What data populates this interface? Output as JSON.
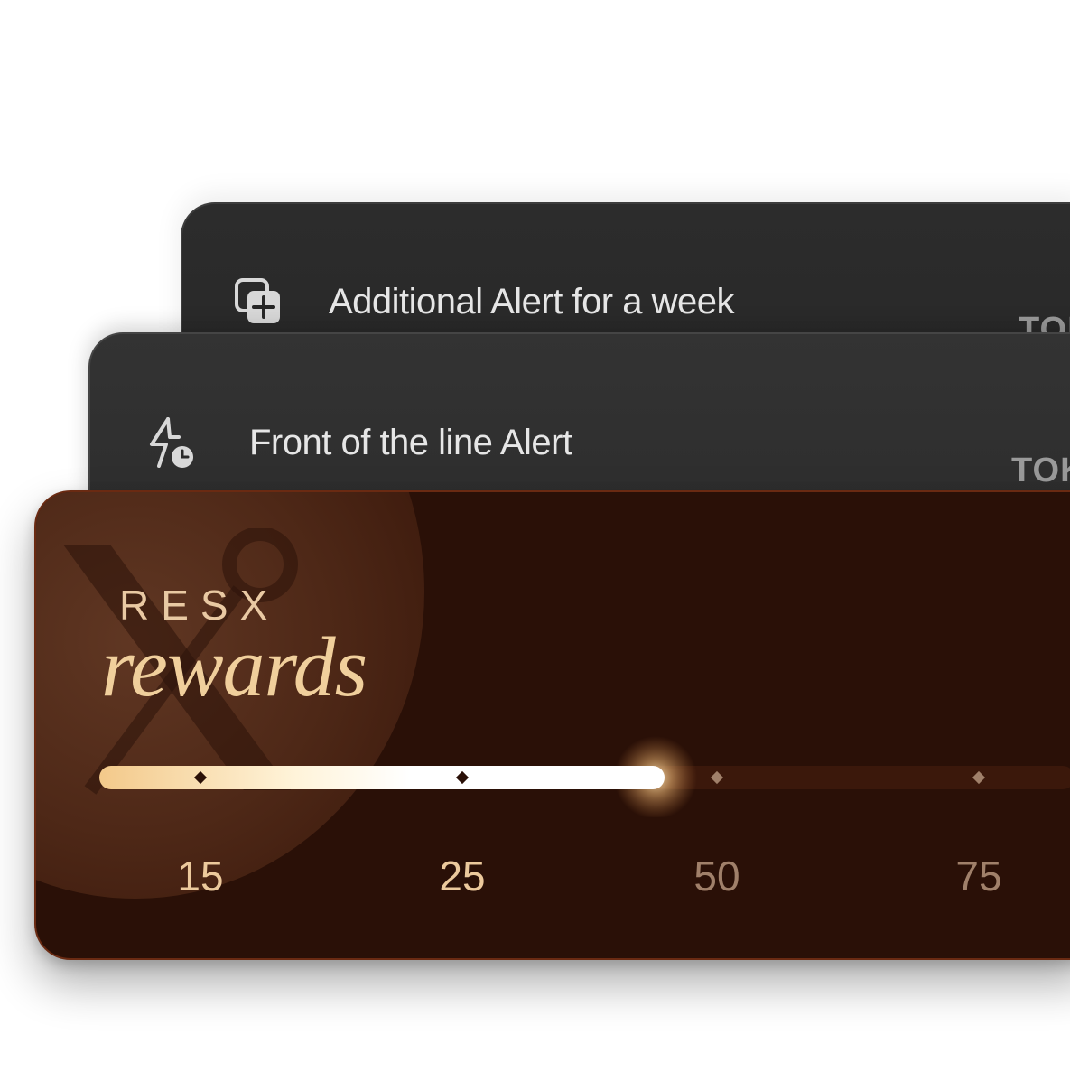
{
  "alerts": [
    {
      "label": "Additional Alert for a week",
      "token_badge": "TOK",
      "icon": "copy-plus-icon"
    },
    {
      "label": "Front of the line Alert",
      "token_badge": "TOK",
      "icon": "lightning-clock-icon"
    }
  ],
  "rewards": {
    "brand_top": "RESX",
    "brand_script": "rewards",
    "logo": "resx-emblem",
    "progress_fraction": 0.5,
    "milestones": [
      {
        "label": "15",
        "reached": true
      },
      {
        "label": "25",
        "reached": true
      },
      {
        "label": "50",
        "reached": false
      },
      {
        "label": "75",
        "reached": false
      }
    ]
  },
  "colors": {
    "card_dark": "#2c2c2c",
    "rewards_bg": "#2a1007",
    "gold": "#f0cf9c",
    "progress_fill": "#ffffff",
    "inactive": "#a0806a"
  }
}
